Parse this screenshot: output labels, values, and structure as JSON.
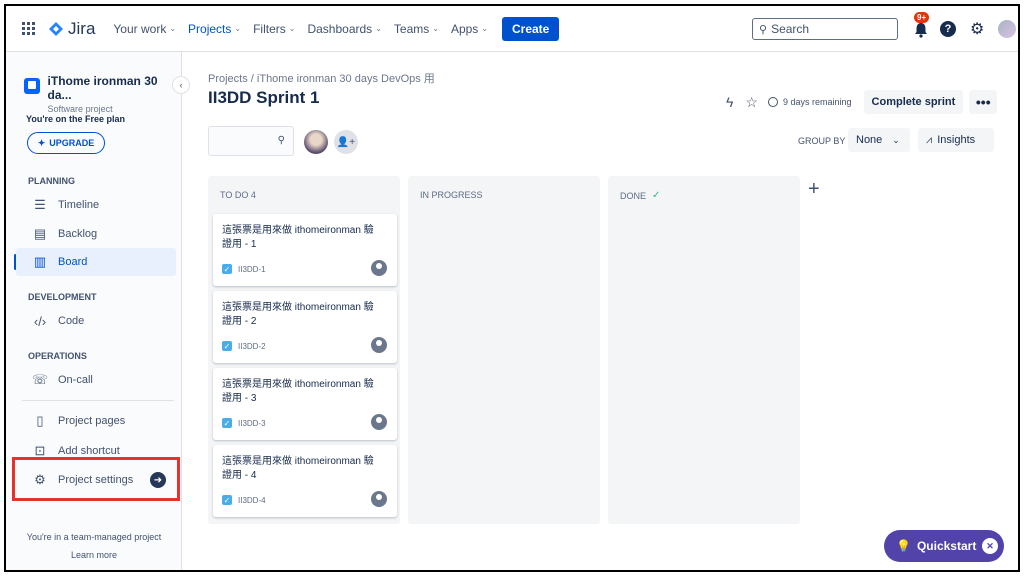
{
  "topnav": {
    "logo": "Jira",
    "items": [
      {
        "label": "Your work",
        "active": false
      },
      {
        "label": "Projects",
        "active": true
      },
      {
        "label": "Filters",
        "active": false
      },
      {
        "label": "Dashboards",
        "active": false
      },
      {
        "label": "Teams",
        "active": false
      },
      {
        "label": "Apps",
        "active": false
      }
    ],
    "create_label": "Create",
    "search_placeholder": "Search",
    "notification_badge": "9+",
    "help_label": "?"
  },
  "sidebar": {
    "project_name": "iThome ironman 30 da...",
    "project_type": "Software project",
    "plan_text": "You're on the Free plan",
    "upgrade_label": "UPGRADE",
    "planning_heading": "PLANNING",
    "timeline_label": "Timeline",
    "backlog_label": "Backlog",
    "board_label": "Board",
    "development_heading": "DEVELOPMENT",
    "code_label": "Code",
    "operations_heading": "OPERATIONS",
    "oncall_label": "On-call",
    "project_pages_label": "Project pages",
    "add_shortcut_label": "Add shortcut",
    "project_settings_label": "Project settings",
    "team_note": "You're in a team-managed project",
    "learn_more": "Learn more"
  },
  "main": {
    "breadcrumb": "Projects  /  iThome ironman 30 days DevOps 用",
    "title": "II3DD Sprint 1",
    "days_remaining": "9 days remaining",
    "complete_label": "Complete sprint",
    "more_label": "•••",
    "groupby_label": "GROUP BY",
    "groupby_value": "None",
    "insights_label": "Insights"
  },
  "columns": [
    {
      "title": "TO DO 4"
    },
    {
      "title": "IN PROGRESS"
    },
    {
      "title": "DONE"
    }
  ],
  "cards": [
    {
      "title": "這張票是用來做 ithomeironman 驗證用 - 1",
      "key": "II3DD-1"
    },
    {
      "title": "這張票是用來做 ithomeironman 驗證用 - 2",
      "key": "II3DD-2"
    },
    {
      "title": "這張票是用來做 ithomeironman 驗證用 - 3",
      "key": "II3DD-3"
    },
    {
      "title": "這張票是用來做 ithomeironman 驗證用 - 4",
      "key": "II3DD-4"
    }
  ],
  "quickstart_label": "Quickstart",
  "colors": {
    "brand": "#0052cc",
    "highlight": "#e5322d",
    "quickstart": "#5243aa"
  }
}
